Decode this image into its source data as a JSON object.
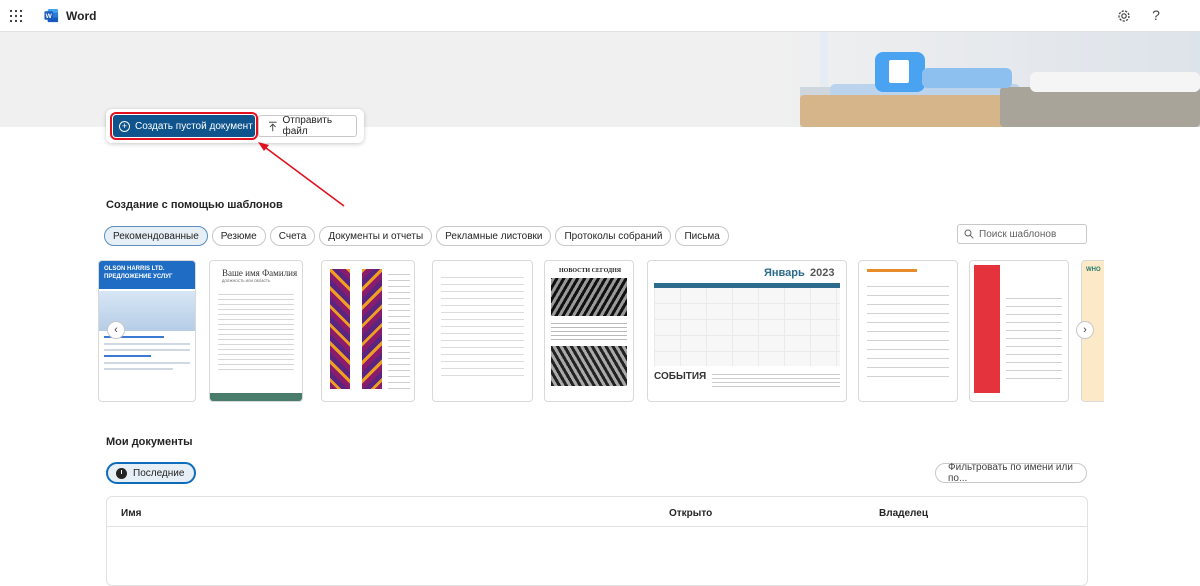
{
  "topbar": {
    "app_name": "Word",
    "help_label": "?"
  },
  "hero": {
    "new_doc_label": "Создать пустой документ",
    "upload_label": "Отправить файл"
  },
  "templates_section": {
    "title": "Создание с помощью шаблонов",
    "categories": [
      "Рекомендованные",
      "Резюме",
      "Счета",
      "Документы и отчеты",
      "Рекламные листовки",
      "Протоколы собраний",
      "Письма"
    ],
    "active_category": "Рекомендованные",
    "search_placeholder": "Поиск шаблонов",
    "cards": [
      {
        "title": "OLSON HARRIS LTD. ПРЕДЛОЖЕНИЕ УСЛУГ"
      },
      {
        "title": "Ваше имя Фамилия",
        "subtitle": "ДОЛЖНОСТЬ ИЛИ ОБЛАСТЬ"
      },
      {
        "title": ""
      },
      {
        "title": ""
      },
      {
        "title": "НОВОСТИ СЕГОДНЯ"
      },
      {
        "title": "Январь",
        "year": "2023",
        "footer": "СОБЫТИЯ"
      },
      {
        "title": ""
      },
      {
        "title": ""
      },
      {
        "title": "WHO"
      }
    ]
  },
  "my_docs": {
    "title": "Мои документы",
    "recent_label": "Последние",
    "filter_placeholder": "Фильтровать по имени или по...",
    "columns": [
      "Имя",
      "Открыто",
      "Владелец"
    ]
  },
  "colors": {
    "accent": "#0f548c",
    "highlight": "#e3101e",
    "word_blue": "#185abd"
  }
}
